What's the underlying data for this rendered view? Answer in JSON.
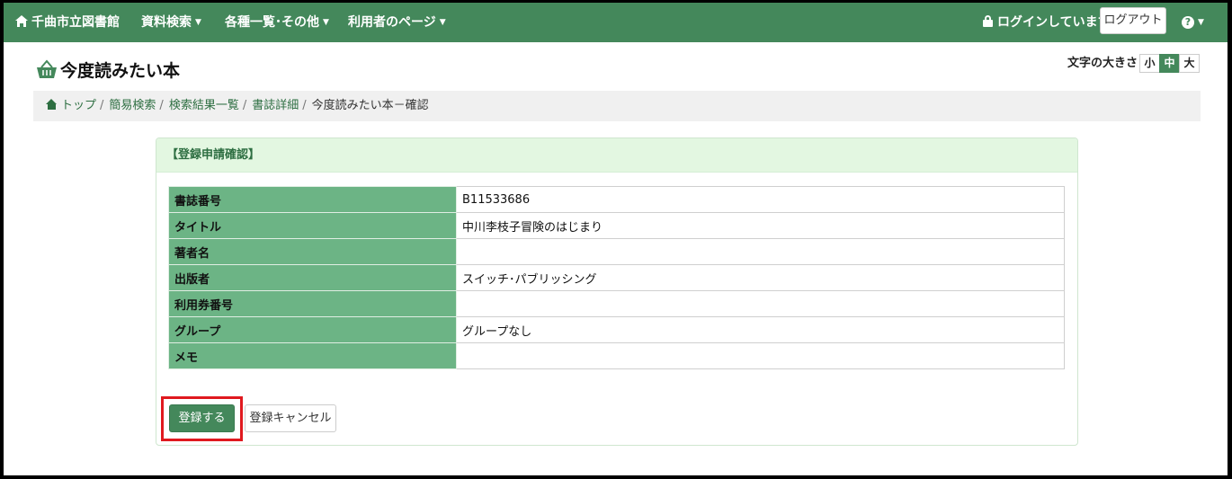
{
  "navbar": {
    "brand": "千曲市立図書館",
    "menus": [
      {
        "label": "資料検索"
      },
      {
        "label": "各種一覧･その他"
      },
      {
        "label": "利用者のページ"
      }
    ],
    "login_status": "ログインしています",
    "logout_label": "ログアウト",
    "help_icon": "question-circle-icon",
    "caret_glyph": "▼"
  },
  "page": {
    "title": "今度読みたい本",
    "title_icon": "basket-icon"
  },
  "font_size": {
    "label": "文字の大きさ",
    "options": [
      "小",
      "中",
      "大"
    ],
    "selected": "中"
  },
  "breadcrumb": {
    "items": [
      "トップ",
      "簡易検索",
      "検索結果一覧",
      "書誌詳細"
    ],
    "separator": "/",
    "current": "今度読みたい本－確認"
  },
  "panel": {
    "heading": "【登録申請確認】",
    "rows": [
      {
        "label": "書誌番号",
        "value": "B11533686"
      },
      {
        "label": "タイトル",
        "value": "中川李枝子冒険のはじまり"
      },
      {
        "label": "著者名",
        "value": ""
      },
      {
        "label": "出版者",
        "value": "スイッチ･パブリッシング"
      },
      {
        "label": "利用券番号",
        "value": ""
      },
      {
        "label": "グループ",
        "value": "グループなし"
      },
      {
        "label": "メモ",
        "value": ""
      }
    ],
    "submit_label": "登録する",
    "cancel_label": "登録キャンセル"
  },
  "colors": {
    "navbar": "#44885b",
    "table_header": "#6cb485",
    "panel_heading_bg": "#e3f7e1",
    "highlight": "#e0191f"
  }
}
